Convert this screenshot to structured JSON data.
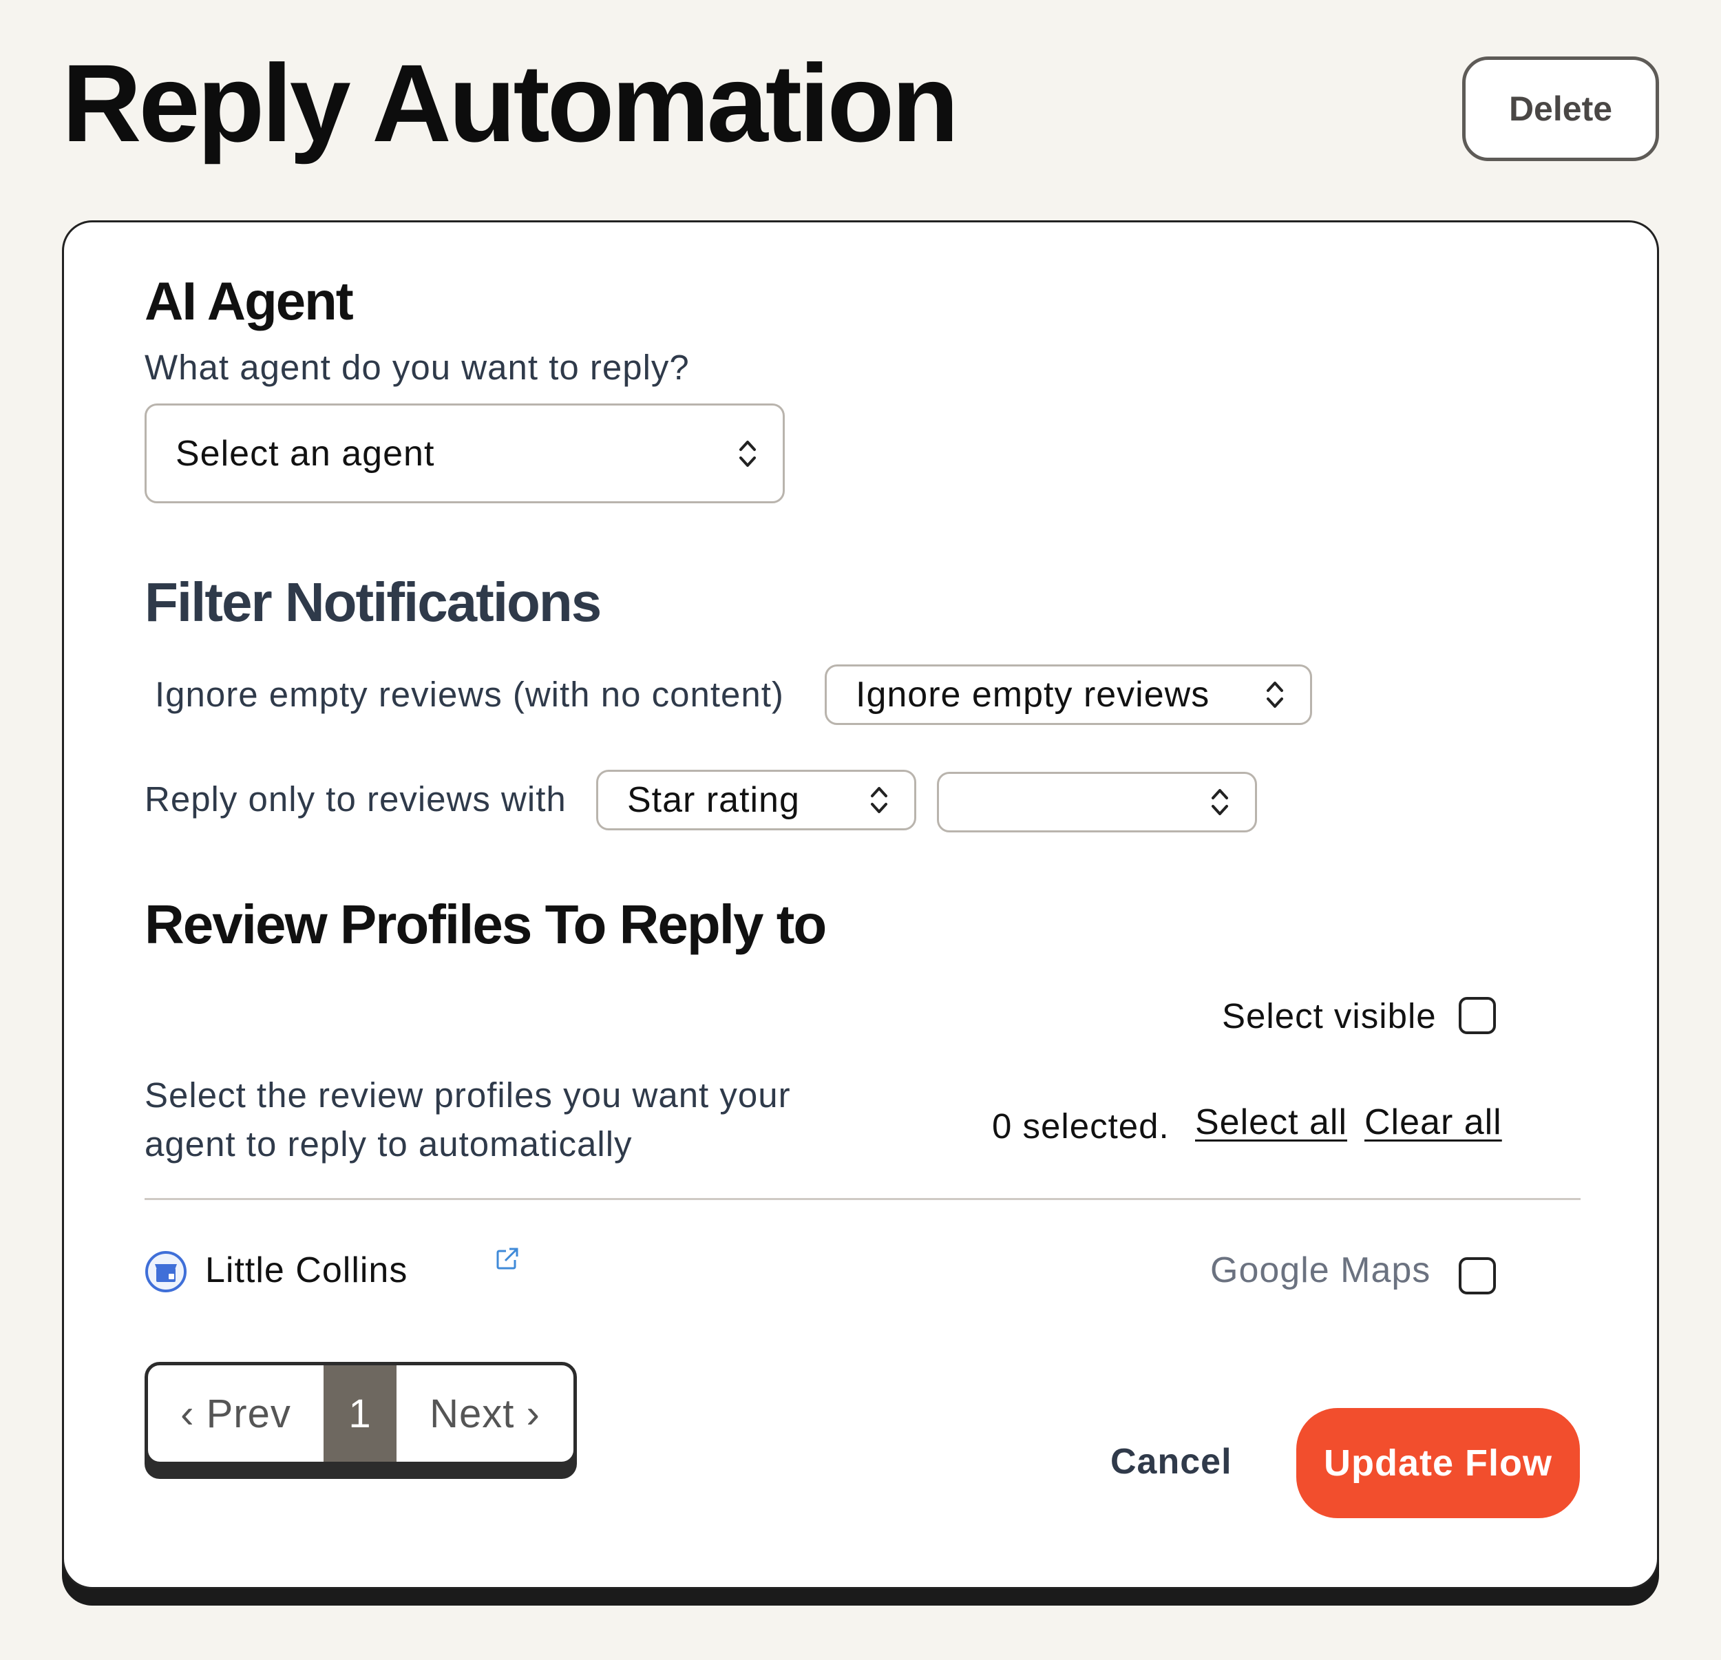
{
  "header": {
    "title": "Reply Automation",
    "delete_label": "Delete"
  },
  "ai_agent": {
    "title": "AI Agent",
    "question": "What agent do you want to reply?",
    "select_placeholder": "Select an agent"
  },
  "filter": {
    "title": "Filter Notifications",
    "ignore_label": "Ignore empty reviews (with no content)",
    "ignore_value": "Ignore empty reviews",
    "reply_only_label": "Reply only to reviews with",
    "reply_only_value": "Star rating",
    "rating_value": ""
  },
  "profiles": {
    "title": "Review Profiles To Reply to",
    "select_visible_label": "Select visible",
    "description": "Select the review profiles you want your agent to reply to automatically",
    "selected_count": "0 selected.",
    "select_all_label": "Select all",
    "clear_all_label": "Clear all",
    "items": [
      {
        "name": "Little Collins",
        "source": "Google Maps",
        "icon": "google-business-icon",
        "link_icon": "external-link-icon"
      }
    ]
  },
  "pagination": {
    "prev_label": "‹ Prev",
    "current_page": "1",
    "next_label": "Next ›"
  },
  "actions": {
    "cancel_label": "Cancel",
    "update_label": "Update Flow"
  },
  "colors": {
    "background": "#f6f4ef",
    "accent": "#f24e2d",
    "pager_active": "#6e6860"
  }
}
